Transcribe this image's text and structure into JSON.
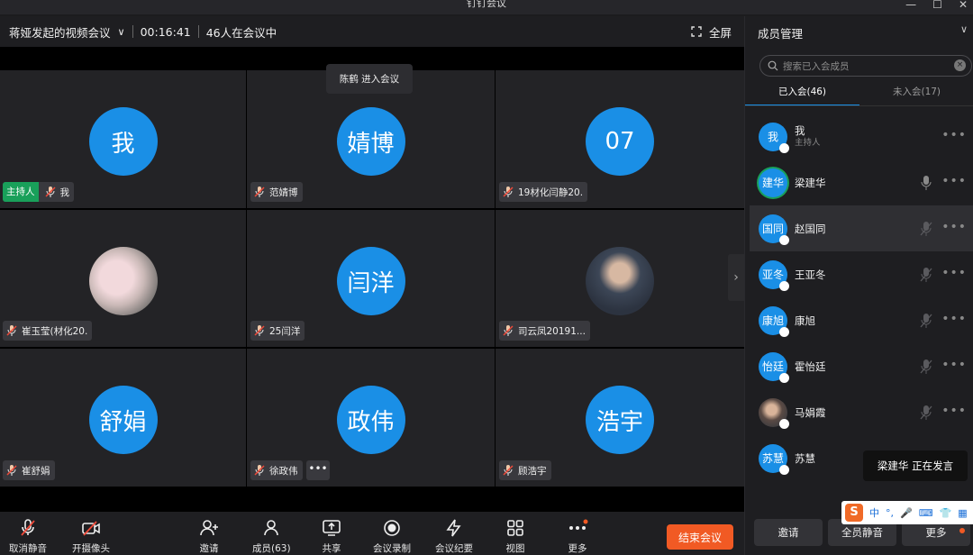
{
  "window": {
    "title": "钉钉会议"
  },
  "topbar": {
    "meeting_title": "蒋娅发起的视频会议",
    "duration": "00:16:41",
    "participants": "46人在会议中",
    "fullscreen": "全屏"
  },
  "toast": "陈鹤 进入会议",
  "tiles": [
    {
      "avatar": "我",
      "name": "我",
      "host_badge": "主持人"
    },
    {
      "avatar": "婧博",
      "name": "范婧博"
    },
    {
      "avatar": "07",
      "name": "19材化闫静20."
    },
    {
      "avatar": "",
      "name": "崔玉莹(材化20."
    },
    {
      "avatar": "闫洋",
      "name": "25闫洋"
    },
    {
      "avatar": "",
      "name": "司云凤20191..."
    },
    {
      "avatar": "舒娟",
      "name": "崔舒娟"
    },
    {
      "avatar": "政伟",
      "name": "徐政伟"
    },
    {
      "avatar": "浩宇",
      "name": "顾浩宇"
    }
  ],
  "toolbar": {
    "unmute": "取消静音",
    "camera": "开摄像头",
    "invite": "邀请",
    "members": "成员(63)",
    "share": "共享",
    "record": "会议录制",
    "minutes": "会议纪要",
    "view": "视图",
    "more": "更多",
    "end": "结束会议"
  },
  "panel": {
    "title": "成员管理",
    "search_placeholder": "搜索已入会成员",
    "tab_joined": "已入会(46)",
    "tab_not_joined": "未入会(17)",
    "members": [
      {
        "avatar": "我",
        "name": "我",
        "sub": "主持人"
      },
      {
        "avatar": "建华",
        "name": "梁建华"
      },
      {
        "avatar": "国同",
        "name": "赵国同"
      },
      {
        "avatar": "亚冬",
        "name": "王亚冬"
      },
      {
        "avatar": "康旭",
        "name": "康旭"
      },
      {
        "avatar": "怡廷",
        "name": "霍怡廷"
      },
      {
        "avatar": "",
        "name": "马娟霞"
      },
      {
        "avatar": "苏慧",
        "name": "苏慧"
      }
    ],
    "btn_invite": "邀请",
    "btn_mute_all": "全员静音",
    "btn_more": "更多"
  },
  "speaking": "梁建华  正在发言",
  "ime": {
    "lang": "中",
    "punct": "°,"
  },
  "colors": {
    "accent": "#1a8fe6",
    "host_badge": "#19a05a",
    "end_button": "#f15a24"
  }
}
